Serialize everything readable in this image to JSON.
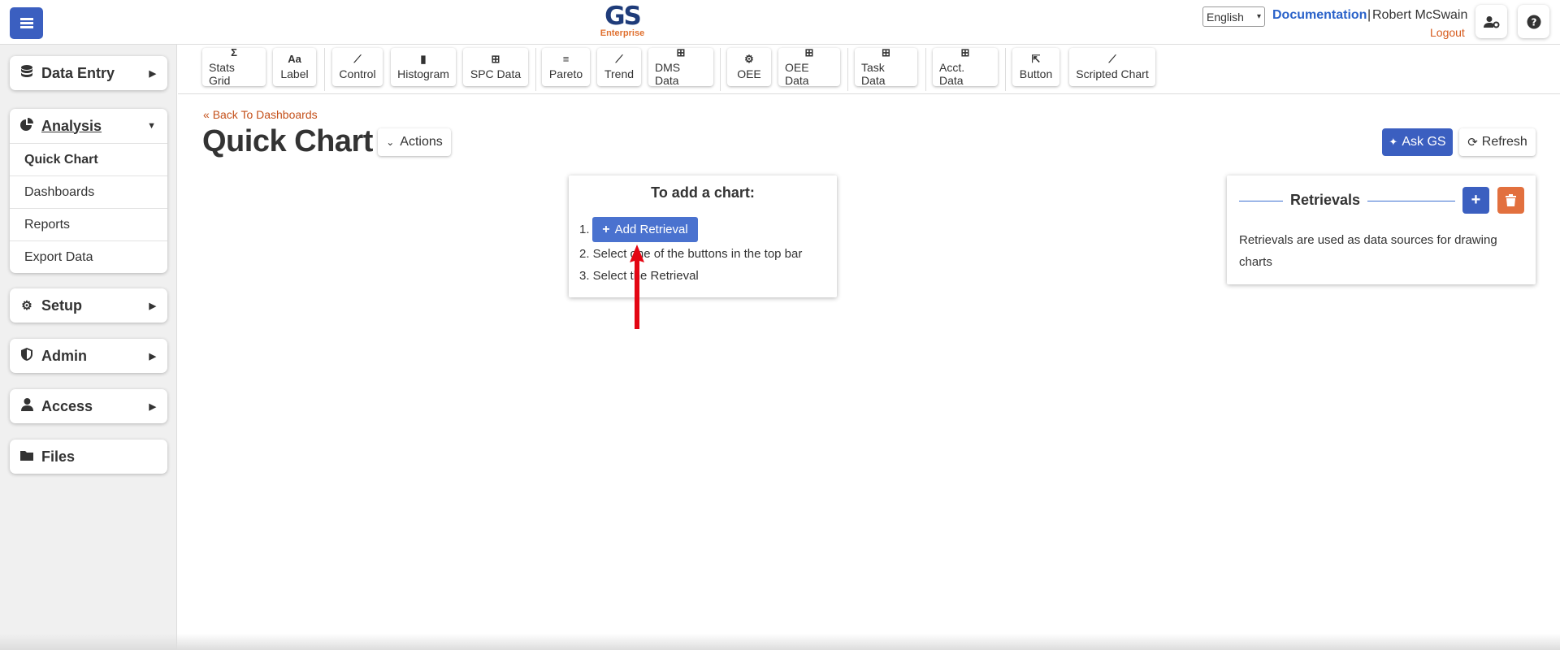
{
  "header": {
    "logo_main": "GS",
    "logo_sub": "Enterprise",
    "language": "English",
    "documentation": "Documentation",
    "separator": "|",
    "user_name": "Robert McSwain",
    "logout": "Logout"
  },
  "sidebar": {
    "data_entry": "Data Entry",
    "analysis": "Analysis",
    "analysis_items": [
      "Quick Chart",
      "Dashboards",
      "Reports",
      "Export Data"
    ],
    "setup": "Setup",
    "admin": "Admin",
    "access": "Access",
    "files": "Files"
  },
  "toolbar": {
    "tools": [
      {
        "label": "Stats Grid",
        "icon": "sigma-icon",
        "glyph": "Σ"
      },
      {
        "label": "Label",
        "icon": "text-icon",
        "glyph": "Aa"
      },
      {
        "label": "Control",
        "icon": "control-chart-icon",
        "glyph": "⟋"
      },
      {
        "label": "Histogram",
        "icon": "histogram-icon",
        "glyph": "▮"
      },
      {
        "label": "SPC Data",
        "icon": "table-icon",
        "glyph": "⊞"
      },
      {
        "label": "Pareto",
        "icon": "pareto-icon",
        "glyph": "≡"
      },
      {
        "label": "Trend",
        "icon": "trend-icon",
        "glyph": "⟋"
      },
      {
        "label": "DMS Data",
        "icon": "table-icon",
        "glyph": "⊞"
      },
      {
        "label": "OEE",
        "icon": "oee-icon",
        "glyph": "⚙"
      },
      {
        "label": "OEE Data",
        "icon": "table-icon",
        "glyph": "⊞"
      },
      {
        "label": "Task Data",
        "icon": "table-icon",
        "glyph": "⊞"
      },
      {
        "label": "Acct. Data",
        "icon": "table-icon",
        "glyph": "⊞"
      },
      {
        "label": "Button",
        "icon": "pointer-icon",
        "glyph": "⇱"
      },
      {
        "label": "Scripted Chart",
        "icon": "script-chart-icon",
        "glyph": "⟋"
      }
    ]
  },
  "main": {
    "back_link": "Back To Dashboards",
    "title": "Quick Chart",
    "actions": "Actions",
    "ask_gs": "Ask GS",
    "refresh": "Refresh"
  },
  "help": {
    "title": "To add a chart:",
    "step1_num": "1.",
    "add_retrieval": "Add Retrieval",
    "step2": "2. Select one of the buttons in the top bar",
    "step3": "3. Select the Retrieval"
  },
  "retrievals": {
    "title": "Retrievals",
    "description": "Retrievals are used as data sources for drawing charts"
  },
  "colors": {
    "primary": "#3b5fc0",
    "accent_orange": "#e2703e",
    "link_blue": "#2a62c9",
    "arrow_red": "#e30613"
  }
}
